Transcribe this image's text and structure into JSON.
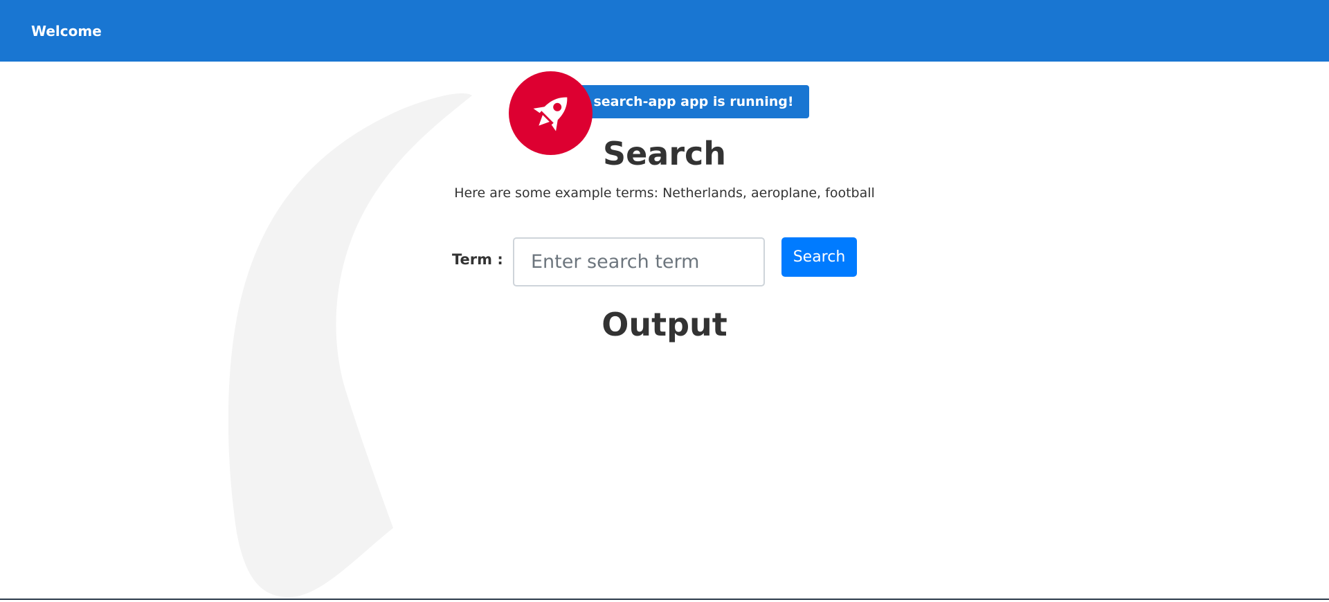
{
  "toolbar": {
    "title": "Welcome",
    "background_color": "#1976d2"
  },
  "hero": {
    "icon": "rocket-icon",
    "icon_circle_color": "#dd0031",
    "running_message": "search-app app is running!"
  },
  "search_section": {
    "heading": "Search",
    "example_text": "Here are some example terms: Netherlands, aeroplane, football",
    "term_label": "Term :",
    "input_placeholder": "Enter search term",
    "input_value": "",
    "button_label": "Search",
    "button_color": "#007bff"
  },
  "output_section": {
    "heading": "Output"
  }
}
